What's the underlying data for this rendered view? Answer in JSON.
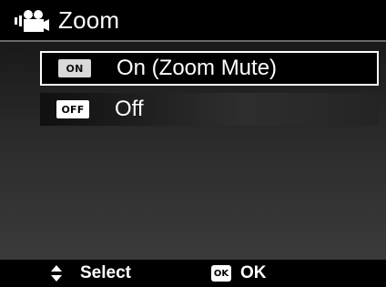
{
  "header": {
    "title": "Zoom",
    "icon": "video-camera-icon"
  },
  "menu": {
    "items": [
      {
        "badge": "ON",
        "label": "On (Zoom Mute)",
        "selected": true
      },
      {
        "badge": "OFF",
        "label": "Off",
        "selected": false
      }
    ]
  },
  "footer": {
    "select_label": "Select",
    "select_icon": "up-down-arrows-icon",
    "ok_badge": "OK",
    "ok_label": "OK"
  },
  "colors": {
    "background": "#000000",
    "text": "#ffffff",
    "selection_border": "#ffffff"
  }
}
